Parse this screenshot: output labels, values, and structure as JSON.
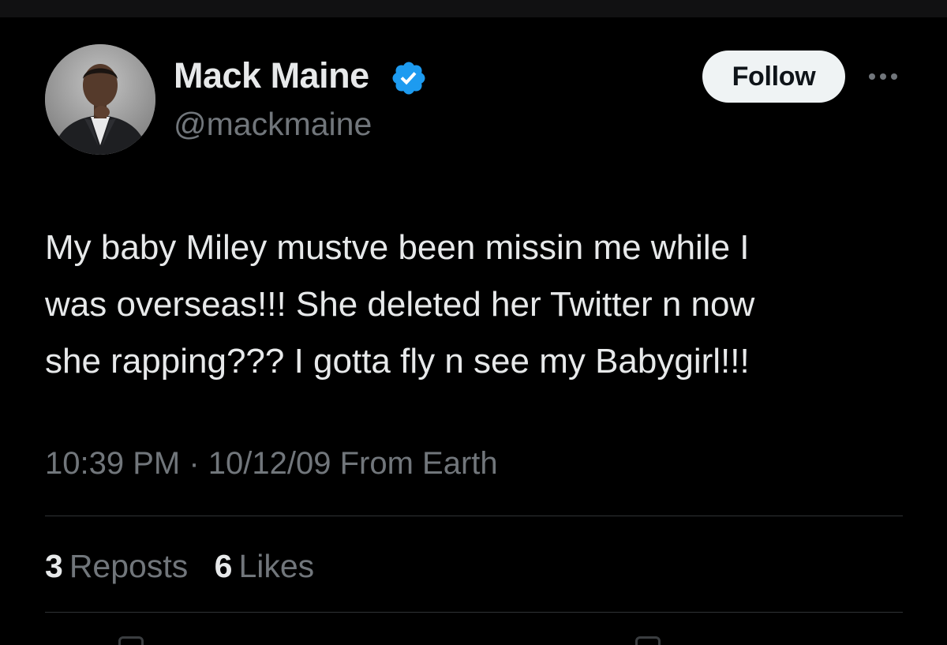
{
  "author": {
    "name": "Mack Maine",
    "handle": "@mackmaine",
    "verified": true
  },
  "header_actions": {
    "follow_label": "Follow",
    "more_icon": "more-horizontal-icon"
  },
  "tweet": {
    "text": "My baby Miley mustve been missin me while I\nwas overseas!!! She deleted her Twitter n now\nshe rapping??? I gotta fly n see my Babygirl!!!",
    "time": "10:39 PM",
    "separator": "·",
    "date": "10/12/09",
    "source": "From Earth"
  },
  "stats": {
    "reposts_count": "3",
    "reposts_label": "Reposts",
    "likes_count": "6",
    "likes_label": "Likes"
  },
  "colors": {
    "background": "#000000",
    "primary_text": "#e7e9ea",
    "secondary_text": "#71767b",
    "verified_blue": "#1d9bf0",
    "divider": "#2f3336",
    "follow_button_bg": "#eff3f4"
  }
}
